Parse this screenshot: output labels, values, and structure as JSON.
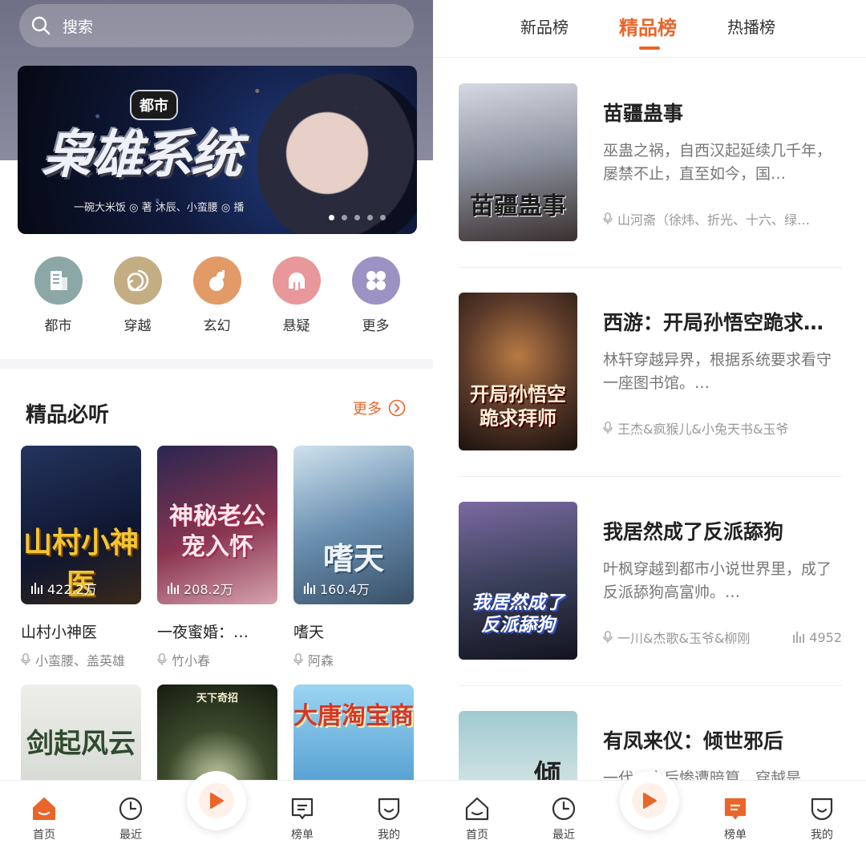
{
  "colors": {
    "accent": "#e8662a",
    "hero_bg": "#7a7a90",
    "text_main": "#222222",
    "text_sub": "#888888"
  },
  "left": {
    "search": {
      "placeholder": "搜索",
      "icon": "search-icon"
    },
    "banner": {
      "tag": "都市",
      "title": "枭雄系统",
      "credit": "一碗大米饭 ◎ 著    沐辰、小蛮腰 ◎ 播",
      "dots": 5,
      "active_dot": 0
    },
    "categories": [
      {
        "label": "都市",
        "icon": "city-building-icon",
        "color": "#8ba8a6"
      },
      {
        "label": "穿越",
        "icon": "spiral-vortex-icon",
        "color": "#c3ad83"
      },
      {
        "label": "玄幻",
        "icon": "gourd-icon",
        "color": "#e29a66"
      },
      {
        "label": "悬疑",
        "icon": "helmet-icon",
        "color": "#e8989a"
      },
      {
        "label": "更多",
        "icon": "four-petal-more-icon",
        "color": "#9d92c4"
      }
    ],
    "section": {
      "title": "精品必听",
      "more": "更多"
    },
    "books": [
      {
        "title": "山村小神医",
        "author": "小蛮腰、盖英雄",
        "plays": "422.2万",
        "cover_text": "山村小神医",
        "cover_bg": "#1d2a4a",
        "cover_fg": "#f5c531"
      },
      {
        "title": "一夜蜜婚：…",
        "author": "竹小春",
        "plays": "208.2万",
        "cover_text": "神秘老公宠入怀",
        "cover_bg": "#6b2b3c",
        "cover_fg": "#f7d6df"
      },
      {
        "title": "嗜天",
        "author": "阿森",
        "plays": "160.4万",
        "cover_text": "嗜天",
        "cover_bg": "#6a8fb0",
        "cover_fg": "#eef4fa"
      },
      {
        "cover_text": "剑起风云",
        "cover_bg": "#d9ddd6",
        "cover_fg": "#2f4a2f"
      },
      {
        "cover_text": "天下奇招",
        "cover_bg": "#2c3a24",
        "cover_fg": "#e8e4cf"
      },
      {
        "cover_text": "大唐淘宝商",
        "cover_bg": "#7cc0e6",
        "cover_fg": "#d9342b"
      }
    ]
  },
  "right": {
    "tabs": [
      {
        "label": "新品榜"
      },
      {
        "label": "精品榜",
        "active": true
      },
      {
        "label": "热播榜"
      }
    ],
    "items": [
      {
        "title": "苗疆蛊事",
        "desc": "巫蛊之祸，自西汉起延续几千年，屡禁不止，直至如今，国…",
        "authors": "山河斋（徐炜、折光、十六、绿…",
        "plays": "",
        "cover_text": "苗疆蛊事",
        "cover_bg": "#8a8f9c"
      },
      {
        "title": "西游：开局孙悟空跪求…",
        "desc": "林轩穿越异界，根据系统要求看守一座图书馆。…",
        "authors": "王杰&疯猴儿&小兔天书&玉爷",
        "plays": "",
        "cover_text": "开局孙悟空跪求拜师",
        "cover_bg": "#5b3a2a"
      },
      {
        "title": "我居然成了反派舔狗",
        "desc": "叶枫穿越到都市小说世界里，成了反派舔狗高富帅。…",
        "authors": "一川&杰歌&玉爷&柳刚",
        "plays": "4952",
        "cover_text": "我居然成了反派舔狗",
        "cover_bg": "#3a3f5a"
      },
      {
        "title": "有凤来仪：倾世邪后",
        "desc": "一代…之后惨遭暗算，穿越是",
        "authors": "",
        "plays": "",
        "cover_text": "倾",
        "cover_bg": "#c9dfe0"
      }
    ]
  },
  "nav": {
    "left": [
      {
        "label": "首页",
        "icon": "home-icon",
        "active": true
      },
      {
        "label": "最近",
        "icon": "clock-icon"
      },
      {
        "label": "榜单",
        "icon": "chart-list-icon"
      },
      {
        "label": "我的",
        "icon": "profile-smile-icon"
      }
    ],
    "right": [
      {
        "label": "首页",
        "icon": "home-icon"
      },
      {
        "label": "最近",
        "icon": "clock-icon"
      },
      {
        "label": "榜单",
        "icon": "chart-list-icon",
        "active": true
      },
      {
        "label": "我的",
        "icon": "profile-smile-icon"
      }
    ]
  }
}
